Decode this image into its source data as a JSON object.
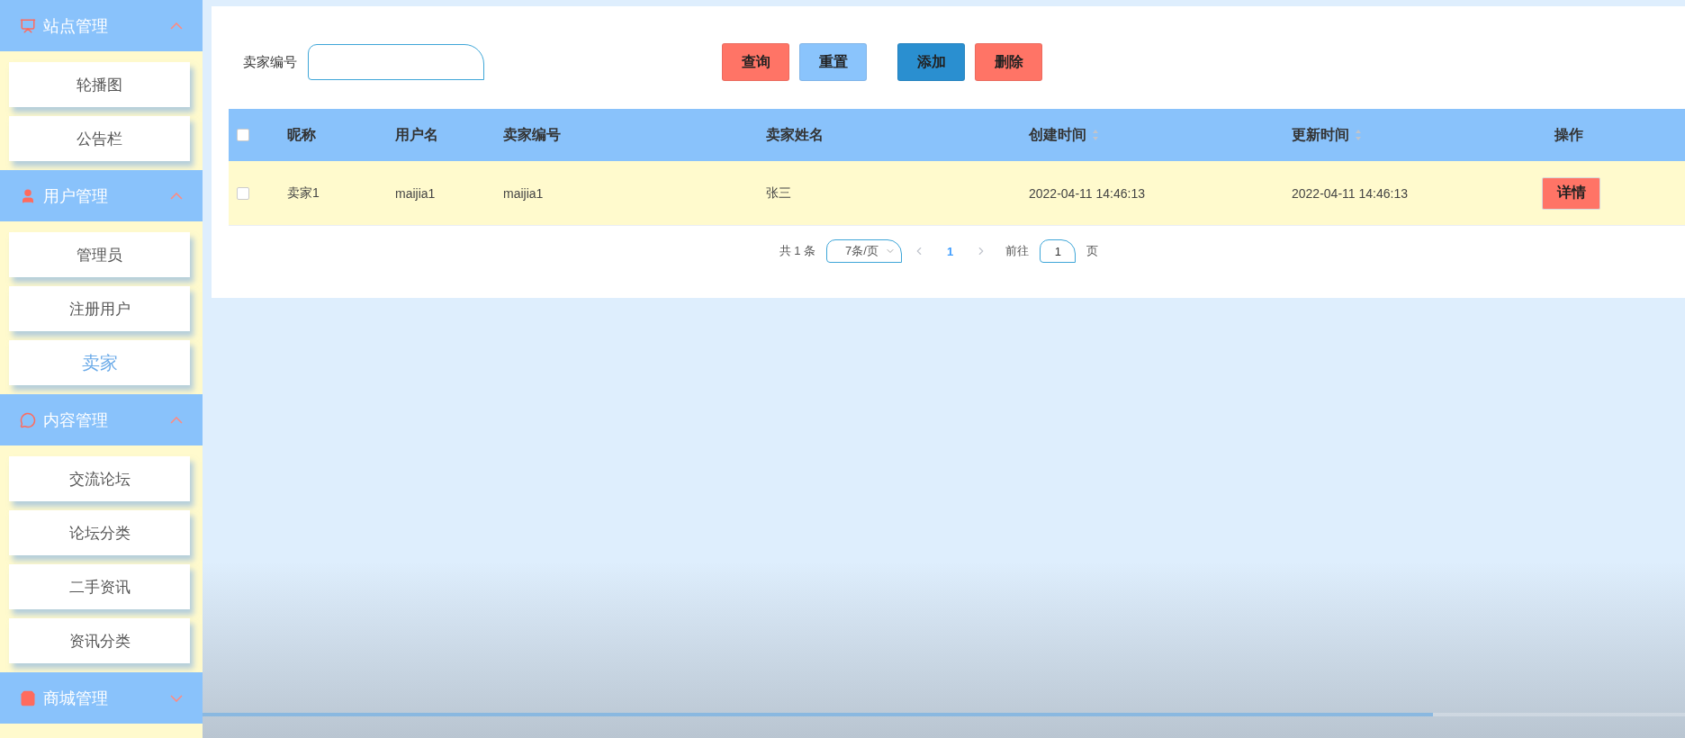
{
  "sidebar": {
    "groups": [
      {
        "title": "站点管理",
        "expanded": true,
        "items": [
          {
            "label": "轮播图",
            "selected": false
          },
          {
            "label": "公告栏",
            "selected": false
          }
        ]
      },
      {
        "title": "用户管理",
        "expanded": true,
        "items": [
          {
            "label": "管理员",
            "selected": false
          },
          {
            "label": "注册用户",
            "selected": false
          },
          {
            "label": "卖家",
            "selected": true
          }
        ]
      },
      {
        "title": "内容管理",
        "expanded": true,
        "items": [
          {
            "label": "交流论坛",
            "selected": false
          },
          {
            "label": "论坛分类",
            "selected": false
          },
          {
            "label": "二手资讯",
            "selected": false
          },
          {
            "label": "资讯分类",
            "selected": false
          }
        ]
      },
      {
        "title": "商城管理",
        "expanded": false
      }
    ]
  },
  "search": {
    "label": "卖家编号"
  },
  "buttons": [
    {
      "label": "查询",
      "kind": "query"
    },
    {
      "label": "重置",
      "kind": "reset"
    },
    {
      "label": "添加",
      "kind": "add"
    },
    {
      "label": "删除",
      "kind": "delete"
    }
  ],
  "table": {
    "columns": [
      {
        "label": "昵称",
        "sortable": false
      },
      {
        "label": "用户名",
        "sortable": false
      },
      {
        "label": "卖家编号",
        "sortable": false
      },
      {
        "label": "卖家姓名",
        "sortable": false
      },
      {
        "label": "创建时间",
        "sortable": true
      },
      {
        "label": "更新时间",
        "sortable": true
      },
      {
        "label": "操作",
        "sortable": false
      }
    ],
    "header_checked": false,
    "rows": [
      {
        "checked": false,
        "cells": [
          "卖家1",
          "maijia1",
          "maijia1",
          "张三",
          "2022-04-11 14:46:13",
          "2022-04-11 14:46:13"
        ],
        "action": "详情"
      }
    ]
  },
  "video": {
    "level": 0.83
  },
  "pagination": {
    "total": "共 1 条",
    "page_size": "7条/页",
    "pages": [
      {
        "label": "1",
        "selected": true
      }
    ],
    "goto_label": "前往",
    "goto_value": "1",
    "goto_suffix": "页"
  }
}
